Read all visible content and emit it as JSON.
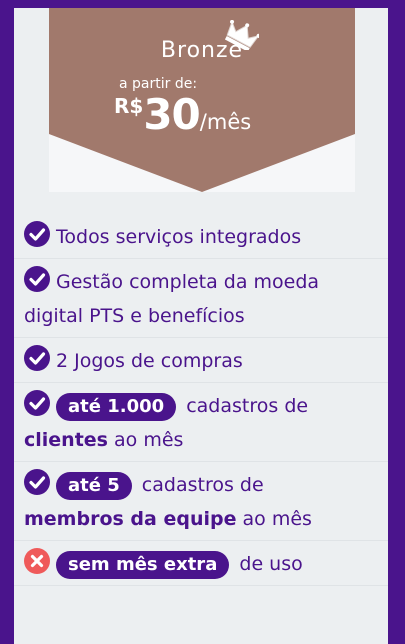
{
  "plan": {
    "name": "Bronze",
    "from_label": "a partir de:",
    "currency": "R$",
    "amount": "30",
    "period": "/mês"
  },
  "colors": {
    "frame": "#4a148c",
    "card_bg": "#eceff1",
    "banner": "#a1796c",
    "check": "#4a148c",
    "cross": "#ef5a5a"
  },
  "features": [
    {
      "icon": "check-circle-icon",
      "text": "Todos serviços integrados"
    },
    {
      "icon": "check-circle-icon",
      "text": "Gestão completa da moeda digital PTS e benefícios"
    },
    {
      "icon": "check-circle-icon",
      "text": "2 Jogos de compras"
    },
    {
      "icon": "check-circle-icon",
      "pill": "até 1.000",
      "text_a": "cadastros de",
      "strong": "clientes",
      "text_b": "ao mês"
    },
    {
      "icon": "check-circle-icon",
      "pill": "até 5",
      "text_a": "cadastros de",
      "strong": "membros da equipe",
      "text_b": "ao mês"
    },
    {
      "icon": "close-circle-icon",
      "pill": "sem mês extra",
      "text_a": "de uso"
    }
  ]
}
